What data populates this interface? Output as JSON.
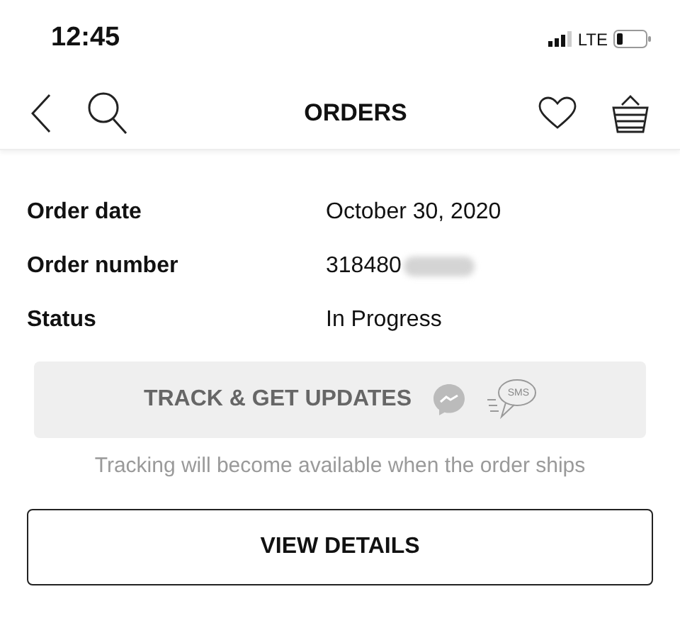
{
  "status_bar": {
    "time": "12:45",
    "network": "LTE"
  },
  "nav": {
    "title": "ORDERS"
  },
  "details": [
    {
      "label": "Order date",
      "value": "October 30, 2020",
      "redacted": false
    },
    {
      "label": "Order number",
      "value": "318480",
      "redacted": true
    },
    {
      "label": "Status",
      "value": "In Progress",
      "redacted": false
    }
  ],
  "track_button": {
    "label": "TRACK & GET UPDATES",
    "disabled": true,
    "sms_icon_text": "SMS"
  },
  "tracking_note": "Tracking will become available when the order ships",
  "view_button": {
    "label": "VIEW DETAILS"
  }
}
